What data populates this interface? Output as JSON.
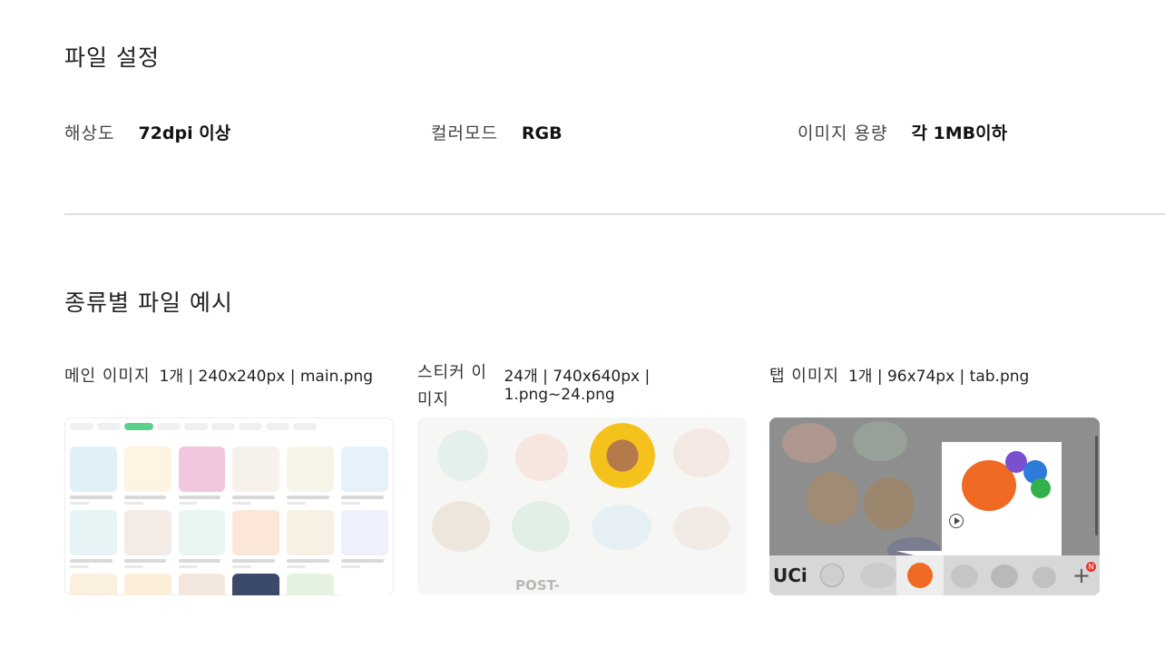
{
  "file_settings": {
    "title": "파일 설정",
    "specs": [
      {
        "label": "해상도",
        "value": "72dpi 이상"
      },
      {
        "label": "컬러모드",
        "value": "RGB"
      },
      {
        "label": "이미지 용량",
        "value": "각 1MB이하"
      }
    ]
  },
  "examples": {
    "title": "종류별 파일 예시",
    "items": [
      {
        "name": "메인 이미지",
        "meta": "1개 | 240x240px | main.png"
      },
      {
        "name": "스티커 이미지",
        "meta": "24개 | 740x640px | 1.png~24.png"
      },
      {
        "name": "탭 이미지",
        "meta": "1개 | 96x74px | tab.png"
      }
    ]
  },
  "thumb_texts": {
    "logo": "UCi",
    "sticker_post": "POST-",
    "badge": "N"
  },
  "colors": {
    "accent_green": "#5bd08d",
    "sunflower": "#f5c21b",
    "badge_red": "#e8382b"
  }
}
